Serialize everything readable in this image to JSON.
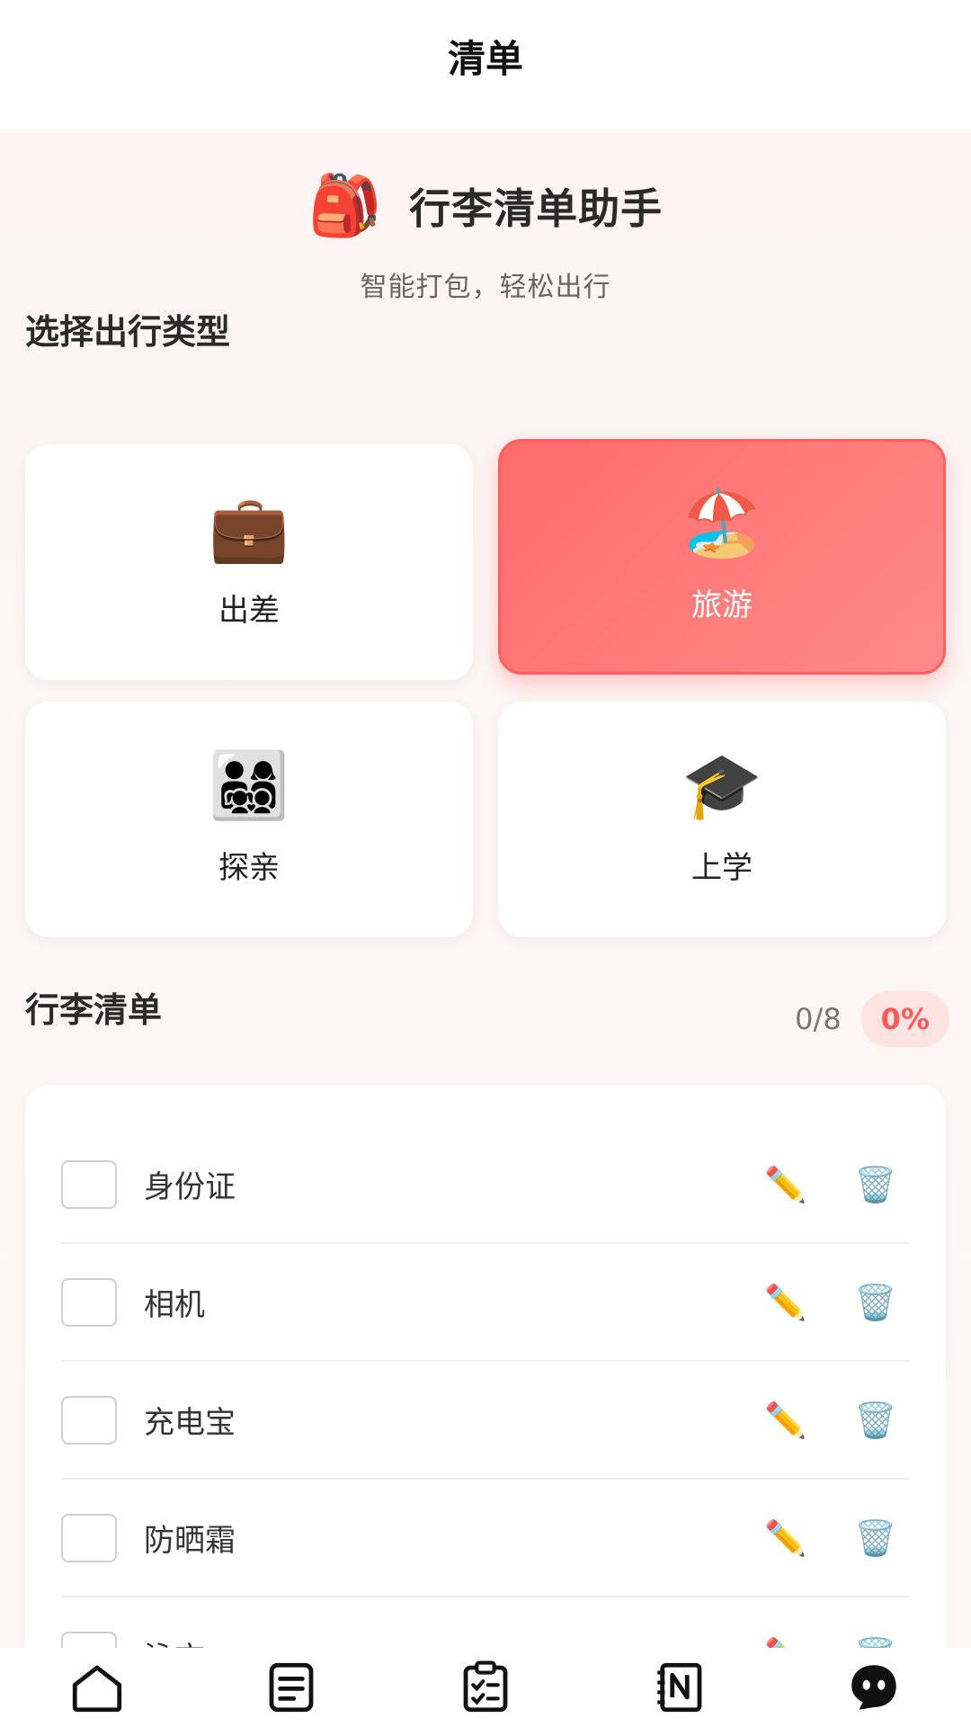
{
  "header": {
    "title": "清单"
  },
  "hero": {
    "icon": "🎒",
    "icon_name": "backpack-icon",
    "title": "行李清单助手",
    "subtitle": "智能打包，轻松出行"
  },
  "trip_types": {
    "section_title": "选择出行类型",
    "items": [
      {
        "label": "出差",
        "icon": "💼",
        "icon_name": "briefcase-icon",
        "selected": false
      },
      {
        "label": "旅游",
        "icon": "🏖️",
        "icon_name": "beach-umbrella-icon",
        "selected": true
      },
      {
        "label": "探亲",
        "icon": "👨‍👩‍👧‍👦",
        "icon_name": "family-icon",
        "selected": false
      },
      {
        "label": "上学",
        "icon": "🎓",
        "icon_name": "graduation-cap-icon",
        "selected": false
      }
    ]
  },
  "luggage": {
    "section_title": "行李清单",
    "count": "0/8",
    "percent": "0%",
    "edit_icon": "✏️",
    "delete_icon": "🗑️",
    "items": [
      {
        "name": "身份证",
        "checked": false
      },
      {
        "name": "相机",
        "checked": false
      },
      {
        "name": "充电宝",
        "checked": false
      },
      {
        "name": "防晒霜",
        "checked": false
      },
      {
        "name": "泳衣",
        "checked": false
      }
    ]
  },
  "bottom_nav": {
    "items": [
      {
        "icon_name": "home-icon"
      },
      {
        "icon_name": "list-icon"
      },
      {
        "icon_name": "checklist-icon"
      },
      {
        "icon_name": "notebook-icon"
      },
      {
        "icon_name": "profile-icon"
      }
    ]
  },
  "colors": {
    "accent": "#ff6b6b",
    "accent_light": "#ffe3e3",
    "background": "#fdf6f5"
  }
}
